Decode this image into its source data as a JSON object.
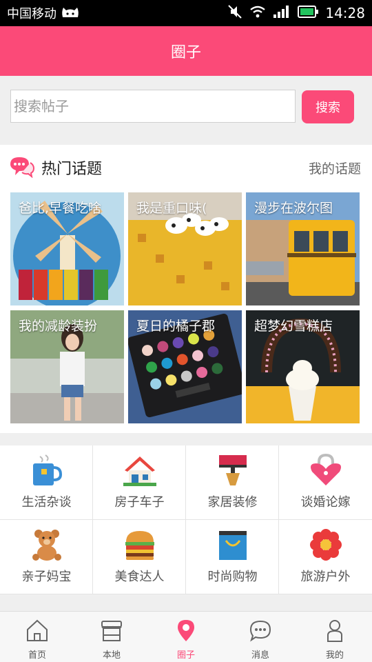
{
  "status": {
    "carrier": "中国移动",
    "time": "14:28"
  },
  "header": {
    "title": "圈子"
  },
  "search": {
    "placeholder": "搜索帖子",
    "button": "搜索"
  },
  "hot": {
    "title": "热门话题",
    "mine": "我的话题",
    "topics": [
      {
        "label": "爸比,早餐吃啥"
      },
      {
        "label": "我是重口味("
      },
      {
        "label": "漫步在波尔图"
      },
      {
        "label": "我的减龄装扮"
      },
      {
        "label": "夏日的橘子郡"
      },
      {
        "label": "超梦幻雪糕店"
      }
    ]
  },
  "categories": [
    {
      "label": "生活杂谈",
      "icon": "mug-icon"
    },
    {
      "label": "房子车子",
      "icon": "house-icon"
    },
    {
      "label": "家居装修",
      "icon": "paint-roller-icon"
    },
    {
      "label": "谈婚论嫁",
      "icon": "heart-lock-icon"
    },
    {
      "label": "亲子妈宝",
      "icon": "teddy-bear-icon"
    },
    {
      "label": "美食达人",
      "icon": "burger-icon"
    },
    {
      "label": "时尚购物",
      "icon": "shopping-bag-icon"
    },
    {
      "label": "旅游户外",
      "icon": "flower-icon"
    }
  ],
  "tabs": [
    {
      "label": "首页",
      "icon": "home-icon"
    },
    {
      "label": "本地",
      "icon": "store-icon"
    },
    {
      "label": "圈子",
      "icon": "location-pin-icon",
      "active": true
    },
    {
      "label": "消息",
      "icon": "chat-icon"
    },
    {
      "label": "我的",
      "icon": "person-icon"
    }
  ],
  "colors": {
    "accent": "#fb4a78"
  }
}
